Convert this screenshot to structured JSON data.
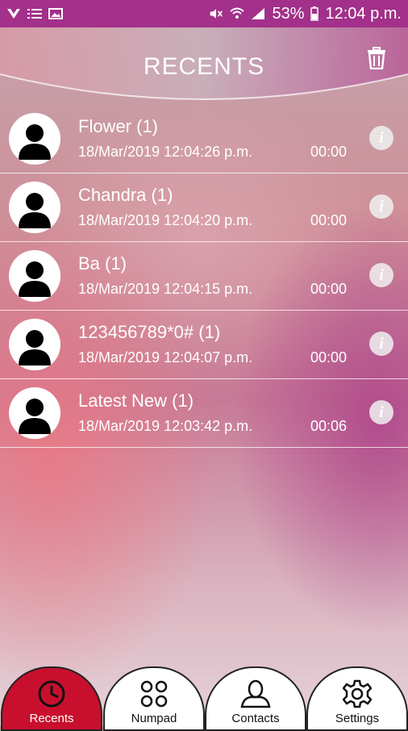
{
  "status_bar": {
    "battery_percent": "53%",
    "clock": "12:04 p.m.",
    "left_icons": [
      "vpn-icon",
      "list-icon",
      "image-icon"
    ],
    "right_icons": [
      "mute-icon",
      "wifi-icon",
      "signal-icon",
      "battery-icon"
    ],
    "bg_color": "#a3308a"
  },
  "header": {
    "title": "RECENTS",
    "delete_icon": "trash-icon"
  },
  "recents": [
    {
      "name": "Flower (1)",
      "datetime": "18/Mar/2019 12:04:26 p.m.",
      "duration": "00:00"
    },
    {
      "name": "Chandra (1)",
      "datetime": "18/Mar/2019 12:04:20 p.m.",
      "duration": "00:00"
    },
    {
      "name": "Ba (1)",
      "datetime": "18/Mar/2019 12:04:15 p.m.",
      "duration": "00:00"
    },
    {
      "name": "123456789*0# (1)",
      "datetime": "18/Mar/2019 12:04:07 p.m.",
      "duration": "00:00"
    },
    {
      "name": "Latest New (1)",
      "datetime": "18/Mar/2019 12:03:42 p.m.",
      "duration": "00:06"
    }
  ],
  "info_glyph": "i",
  "tabs": [
    {
      "label": "Recents",
      "icon": "clock-icon",
      "active": true
    },
    {
      "label": "Numpad",
      "icon": "numpad-icon",
      "active": false
    },
    {
      "label": "Contacts",
      "icon": "contact-icon",
      "active": false
    },
    {
      "label": "Settings",
      "icon": "gear-icon",
      "active": false
    }
  ],
  "colors": {
    "active_tab": "#c8102e",
    "status_bar": "#a3308a"
  }
}
